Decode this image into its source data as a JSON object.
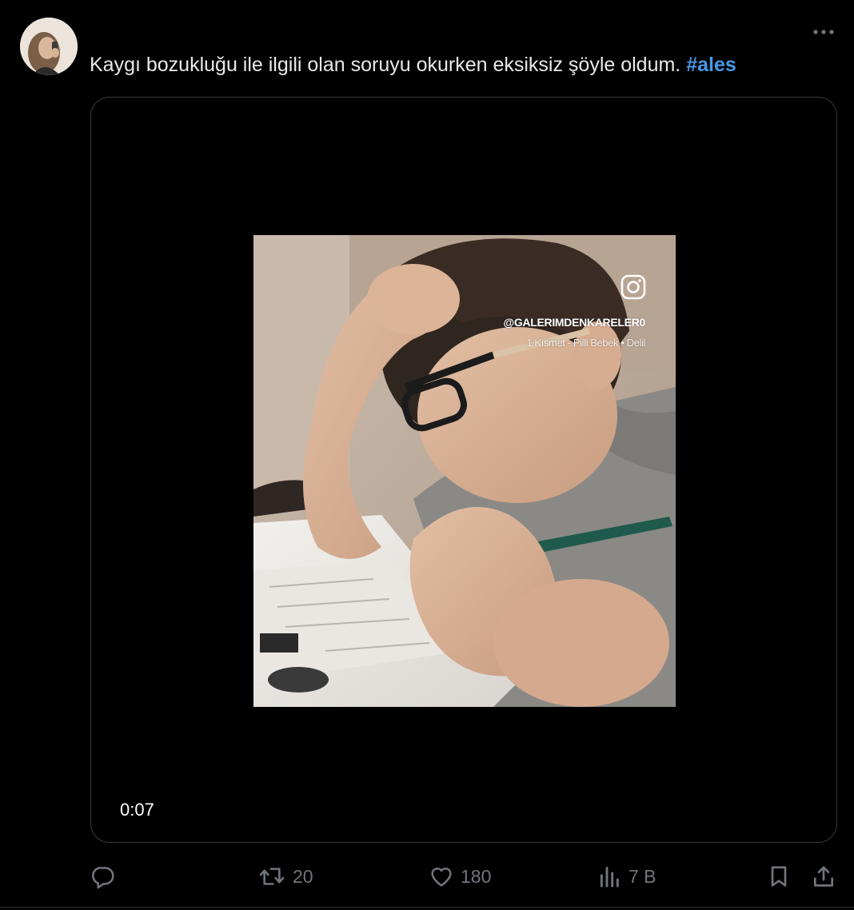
{
  "tweet": {
    "text": "Kaygı bozukluğu ile ilgili olan soruyu okurken eksiksiz şöyle oldum.",
    "hashtag": "#ales",
    "more_icon": "more-horizontal-icon"
  },
  "media": {
    "duration": "0:07",
    "overlay": {
      "icon": "instagram-icon",
      "handle": "@GALERIMDENKARELER0",
      "music": "1 Kısmet - Pilli Bebek • Delil"
    }
  },
  "actions": {
    "reply": {
      "icon": "reply-icon"
    },
    "retweet": {
      "icon": "retweet-icon",
      "count": "20"
    },
    "like": {
      "icon": "heart-icon",
      "count": "180"
    },
    "views": {
      "icon": "views-icon",
      "count": "7 B"
    },
    "bookmark": {
      "icon": "bookmark-icon"
    },
    "share": {
      "icon": "share-icon"
    }
  },
  "colors": {
    "background": "#000000",
    "text": "#e7e9ea",
    "muted": "#71767b",
    "hashtag": "#4a99e9",
    "border": "#38393c"
  }
}
